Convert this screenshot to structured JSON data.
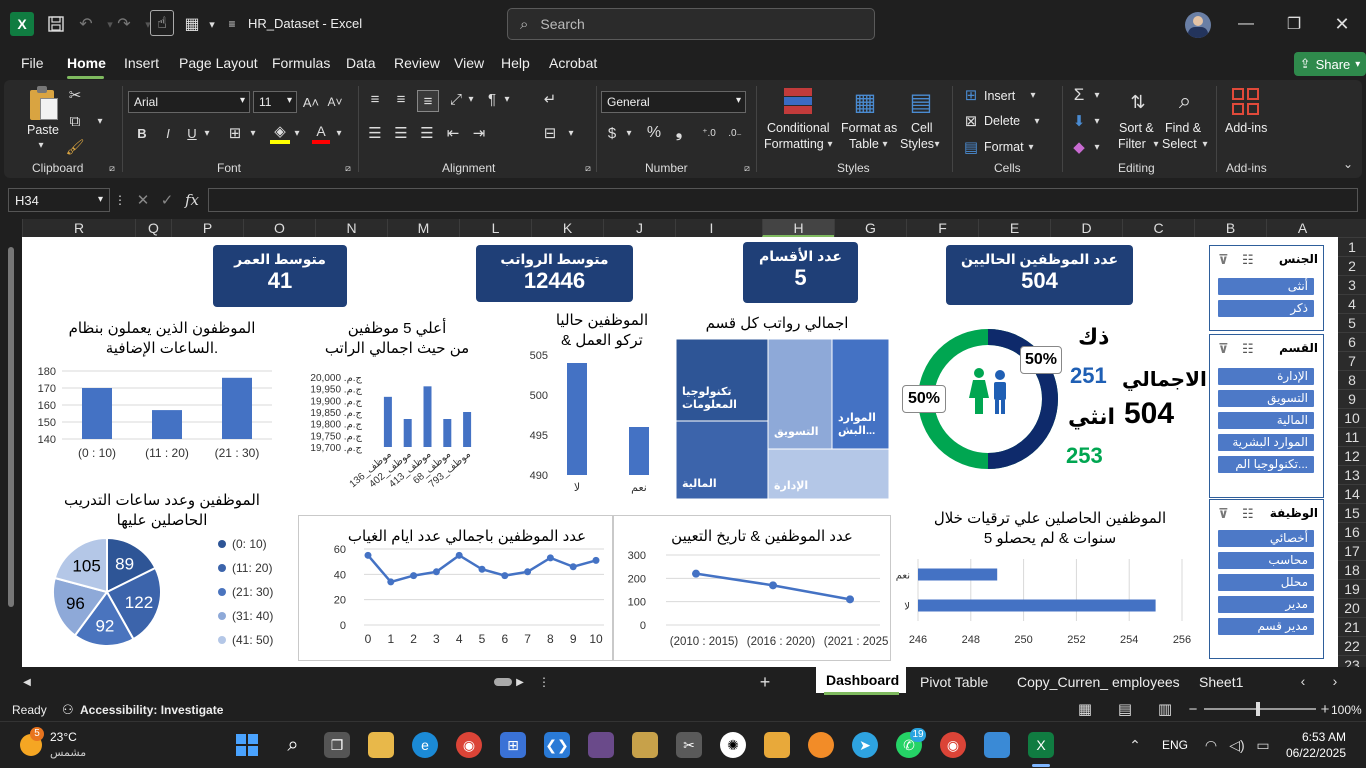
{
  "window": {
    "file_title": "HR_Dataset  -  Excel",
    "search_placeholder": "Search",
    "app_logo": "X"
  },
  "menu": {
    "items": [
      "File",
      "Home",
      "Insert",
      "Page Layout",
      "Formulas",
      "Data",
      "Review",
      "View",
      "Help",
      "Acrobat"
    ],
    "active": "Home",
    "share_label": "Share"
  },
  "ribbon": {
    "clipboard": {
      "paste": "Paste",
      "label": "Clipboard"
    },
    "font": {
      "name": "Arial",
      "size": "11",
      "label": "Font",
      "bold": "B",
      "italic": "I",
      "underline": "U"
    },
    "alignment": {
      "label": "Alignment"
    },
    "number": {
      "format": "General",
      "label": "Number",
      "currency": "$",
      "percent": "%",
      "comma": "❟"
    },
    "styles": {
      "conditional_1": "Conditional",
      "conditional_2": "Formatting",
      "format_as_1": "Format as",
      "format_as_2": "Table",
      "cell_1": "Cell",
      "cell_2": "Styles",
      "label": "Styles"
    },
    "cells": {
      "insert": "Insert",
      "delete": "Delete",
      "format": "Format",
      "label": "Cells"
    },
    "editing": {
      "sort_1": "Sort &",
      "sort_2": "Filter",
      "find_1": "Find &",
      "find_2": "Select",
      "label": "Editing"
    },
    "addins": {
      "btn": "Add-ins",
      "label": "Add-ins"
    }
  },
  "formula_bar": {
    "name_box": "H34",
    "fx": "fx",
    "value": ""
  },
  "columns": [
    "R",
    "Q",
    "P",
    "O",
    "N",
    "M",
    "L",
    "K",
    "J",
    "I",
    "H",
    "G",
    "F",
    "E",
    "D",
    "C",
    "B",
    "A"
  ],
  "selected_column": "H",
  "rows": [
    "1",
    "2",
    "3",
    "4",
    "5",
    "6",
    "7",
    "8",
    "9",
    "10",
    "11",
    "12",
    "13",
    "14",
    "15",
    "16",
    "17",
    "18",
    "19",
    "20",
    "21",
    "22",
    "23"
  ],
  "kpis": [
    {
      "title": "متوسط العمر",
      "value": "41"
    },
    {
      "title": "متوسط الرواتب",
      "value": "12446"
    },
    {
      "title": "عدد الأقسام",
      "value": "5"
    },
    {
      "title": "عدد الموظفين الحاليين",
      "value": "504"
    }
  ],
  "gender_summary": {
    "total_label": "الاجمالي",
    "total_value": "504",
    "male_label": "ذك",
    "male_value": "251",
    "female_label": "انثي",
    "female_value": "253",
    "pct_male": "50%",
    "pct_female": "50%",
    "colors": {
      "male": "#0e2a6b",
      "female": "#00a651",
      "male_text": "#1f5fb4",
      "female_text": "#00a651"
    }
  },
  "slicers": [
    {
      "title": "الجنس",
      "items": [
        "أنثى",
        "ذكر"
      ]
    },
    {
      "title": "القسم",
      "items": [
        "الإدارة",
        "التسويق",
        "المالية",
        "الموارد البشرية",
        "تكنولوجيا الم..."
      ]
    },
    {
      "title": "الوظيفة",
      "items": [
        "أخصائي",
        "محاسب",
        "محلل",
        "مدير",
        "مدير قسم"
      ]
    }
  ],
  "chart_titles": {
    "overtime": [
      "الموظفون الذين يعملون بنظام",
      "الساعات الإضافية."
    ],
    "top5": [
      "أعلي 5 موظفين",
      "من حيث اجمالي الراتب"
    ],
    "current": [
      "الموظفين حاليا",
      "& تركو العمل"
    ],
    "dept_salary": [
      "اجمالي رواتب كل قسم"
    ],
    "training": [
      "الموظفين وعدد ساعات التدريب",
      "الحاصلين عليها"
    ],
    "absence": [
      "عدد الموظفين باجمالي عدد ايام الغياب"
    ],
    "hiring": [
      "عدد الموظفين & تاريخ التعيين"
    ],
    "promotion": [
      "الموظفين الحاصلين علي ترقيات خلال",
      "5 سنوات & لم يحصلو"
    ]
  },
  "chart_data": [
    {
      "type": "bar",
      "title": "الموظفون الذين يعملون بنظام الساعات الإضافية.",
      "categories": [
        "(0 : 10)",
        "(11 : 20)",
        "(21 : 30)"
      ],
      "values": [
        170,
        157,
        176
      ],
      "ylim": [
        140,
        180
      ],
      "yticks": [
        "140",
        "150",
        "160",
        "170",
        "180"
      ],
      "color": "#4472c4"
    },
    {
      "type": "bar",
      "title": "أعلي 5 موظفين من حيث اجمالي الراتب",
      "categories": [
        "موظف_136",
        "موظف_402",
        "موظف_413",
        "موظف_68",
        "موظف_793"
      ],
      "values": [
        19915,
        19820,
        19960,
        19820,
        19850
      ],
      "ylim": [
        19700,
        20000
      ],
      "yticks": [
        "ج.م. 19,700",
        "ج.م. 19,750",
        "ج.م. 19,800",
        "ج.م. 19,850",
        "ج.م. 19,900",
        "ج.م. 19,950",
        "ج.م. 20,000"
      ],
      "color": "#4472c4"
    },
    {
      "type": "bar",
      "title": "الموظفين حاليا & تركو العمل",
      "categories": [
        "لا",
        "نعم"
      ],
      "values": [
        504,
        496
      ],
      "ylim": [
        490,
        505
      ],
      "yticks": [
        "490",
        "495",
        "500",
        "505"
      ],
      "color": "#4472c4"
    },
    {
      "type": "treemap",
      "title": "اجمالي رواتب كل قسم",
      "categories": [
        "تكنولوجيا المعلومات",
        "المالية",
        "التسويق",
        "الموارد البش...",
        "الإدارة"
      ],
      "colors": [
        "#2e5596",
        "#3c64ab",
        "#8ea9d8",
        "#4472c4",
        "#b4c7e7"
      ]
    },
    {
      "type": "pie",
      "title": "الموظفين وعدد ساعات التدريب الحاصلين عليها",
      "categories": [
        "(0: 10)",
        "(11: 20)",
        "(21: 30)",
        "(31: 40)",
        "(41: 50)"
      ],
      "values": [
        89,
        122,
        92,
        96,
        105
      ],
      "colors": [
        "#2e5596",
        "#3c64ab",
        "#4a74be",
        "#8ea9d8",
        "#b4c7e7"
      ]
    },
    {
      "type": "line",
      "title": "عدد الموظفين باجمالي عدد ايام الغياب",
      "x": [
        "0",
        "1",
        "2",
        "3",
        "4",
        "5",
        "6",
        "7",
        "8",
        "9",
        "10"
      ],
      "values": [
        55,
        34,
        39,
        42,
        55,
        44,
        39,
        42,
        53,
        46,
        51
      ],
      "ylim": [
        0,
        60
      ],
      "yticks": [
        "0",
        "20",
        "40",
        "60"
      ],
      "color": "#4472c4"
    },
    {
      "type": "line",
      "title": "عدد الموظفين & تاريخ التعيين",
      "x": [
        "(2010 : 2015)",
        "(2016 : 2020)",
        "(2021 : 2025)"
      ],
      "values": [
        220,
        170,
        110
      ],
      "ylim": [
        0,
        300
      ],
      "yticks": [
        "0",
        "100",
        "200",
        "300"
      ],
      "color": "#4472c4"
    },
    {
      "type": "bar",
      "orientation": "horizontal",
      "title": "الموظفين الحاصلين علي ترقيات خلال 5 سنوات & لم يحصلو",
      "categories": [
        "نعم",
        "لا"
      ],
      "values": [
        249,
        255
      ],
      "xlim": [
        246,
        256
      ],
      "xticks": [
        "246",
        "248",
        "250",
        "252",
        "254",
        "256"
      ],
      "color": "#4472c4"
    }
  ],
  "sheet_tabs": [
    "Dashboard",
    "Pivot Table",
    "Copy_Curren_ employees",
    "Sheet1"
  ],
  "active_tab": "Dashboard",
  "status": {
    "ready": "Ready",
    "accessibility": "Accessibility: Investigate",
    "zoom": "100%"
  },
  "taskbar": {
    "weather_temp": "23°C",
    "weather_desc": "مشمس",
    "weather_badge": "5",
    "language": "ENG",
    "time": "6:53 AM",
    "date": "06/22/2025",
    "whatsapp_badge": "19"
  }
}
